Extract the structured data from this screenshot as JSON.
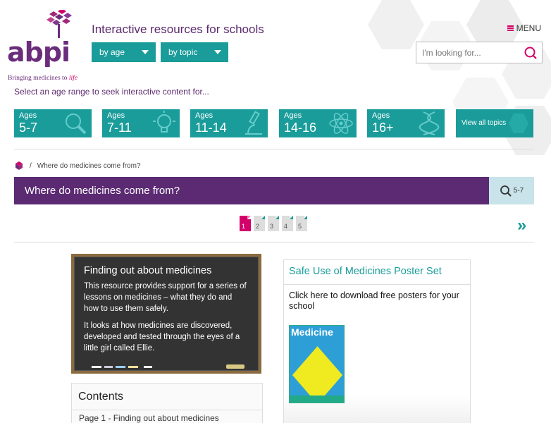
{
  "header": {
    "logo_text": "abpi",
    "tagline_pre": "Bringing medicines to ",
    "tagline_em": "life",
    "site_title": "Interactive resources for schools",
    "dropdown_age": "by age",
    "dropdown_topic": "by topic",
    "menu_label": "MENU",
    "search_placeholder": "I'm looking for..."
  },
  "prompt": "Select an age range to seek interactive content for...",
  "age_tiles": [
    {
      "label": "Ages",
      "range": "5-7",
      "icon": "magnifier-icon"
    },
    {
      "label": "Ages",
      "range": "7-11",
      "icon": "lightbulb-icon"
    },
    {
      "label": "Ages",
      "range": "11-14",
      "icon": "microscope-icon"
    },
    {
      "label": "Ages",
      "range": "14-16",
      "icon": "atom-icon"
    },
    {
      "label": "Ages",
      "range": "16+",
      "icon": "dna-icon"
    }
  ],
  "view_all": "View all topics",
  "breadcrumb": {
    "current": "Where do medicines come from?"
  },
  "page_title": "Where do medicines come from?",
  "level_badge": "5-7",
  "pager": {
    "pages": [
      "1",
      "2",
      "3",
      "4",
      "5"
    ],
    "current": 1,
    "next_glyph": "»"
  },
  "board": {
    "title": "Finding out about medicines",
    "p1": "This resource provides support for a series of lessons on medicines – what they do and how to use them safely.",
    "p2": "It looks at how medicines are discovered, developed and tested through the eyes of a little girl called Ellie."
  },
  "contents": {
    "heading": "Contents",
    "items": [
      "Page 1 - Finding out about medicines"
    ]
  },
  "promo": {
    "title": "Safe Use of Medicines Poster Set",
    "download": "Click here to download free posters for your school",
    "poster_title": "Medicine"
  },
  "colors": {
    "teal": "#1a9c9a",
    "purple": "#5b2a73",
    "magenta": "#d4006a"
  }
}
